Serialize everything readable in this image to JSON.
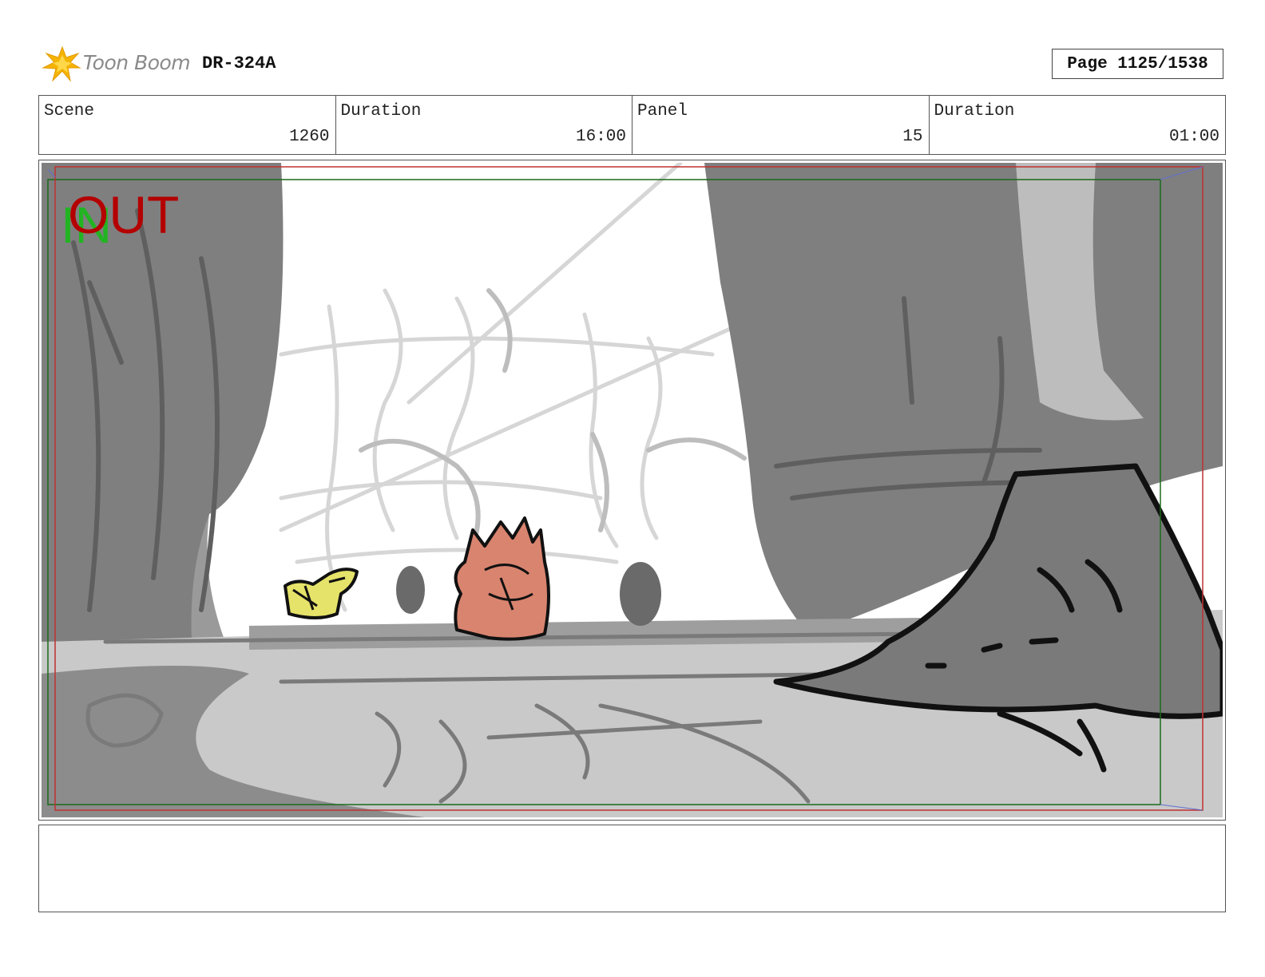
{
  "header": {
    "brand": "Toon Boom",
    "doc_code": "DR-324A",
    "page": "Page 1125/1538"
  },
  "info": [
    {
      "label": "Scene",
      "value": "1260"
    },
    {
      "label": "Duration",
      "value": "16:00"
    },
    {
      "label": "Panel",
      "value": "15"
    },
    {
      "label": "Duration",
      "value": "01:00"
    }
  ],
  "panel": {
    "in_marker": "IN",
    "out_marker": "OUT"
  },
  "notes": {
    "text": ""
  },
  "colors": {
    "in_marker": "#22b422",
    "out_marker": "#b40000",
    "safe_frame_green": "#1a6a1a",
    "safe_frame_red": "#c03030",
    "logo_star": "#f5b400"
  }
}
